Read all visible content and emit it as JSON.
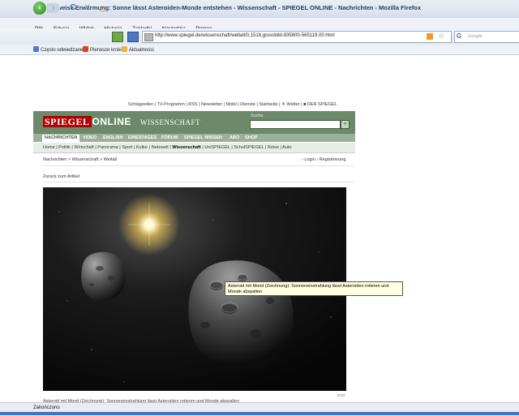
{
  "window": {
    "title": "Teilweise Erwärmung: Sonne lässt Asteroiden-Monde entstehen - Wissenschaft - SPIEGEL ONLINE - Nachrichten - Mozilla Firefox"
  },
  "menu": {
    "items": [
      "Plik",
      "Edycja",
      "Widok",
      "Historia",
      "Zakładki",
      "Narzędzia",
      "Pomoc"
    ]
  },
  "toolbar": {
    "back": "‹",
    "forward": "›",
    "reload": "C",
    "stop": "✕",
    "home": "⌂",
    "url": "http://www.spiegel.de/wissenschaft/weltall/0,1518,grossbild-835800-565119,00.html",
    "search_placeholder": "Google"
  },
  "bookmarks": {
    "items": [
      {
        "label": "Często odwiedzane",
        "color": "#4a7bd0"
      },
      {
        "label": "Pierwsze kroki",
        "color": "#d8431b"
      },
      {
        "label": "Aktualności",
        "color": "#e8b53a"
      }
    ]
  },
  "spiegel": {
    "top_links": "Schlagzeilen | TV-Programm | RSS | Newsletter | Mobil | Dienste | Startseite | ☀ Wetter | ■ DER SPIEGEL",
    "logo_spiegel": "SPIEGEL",
    "logo_online": "ONLINE",
    "section_title": "WISSENSCHAFT",
    "search_label": "Suche",
    "search_button": "»",
    "tabs": [
      "NACHRICHTEN",
      "VIDEO",
      "ENGLISH",
      "EINESTAGES",
      "FORUM",
      "SPIEGEL WISSEN",
      "ABO",
      "SHOP"
    ],
    "subnav": [
      "Home",
      "Politik",
      "Wirtschaft",
      "Panorama",
      "Sport",
      "Kultur",
      "Netzwelt",
      "Wissenschaft",
      "UniSPIEGEL",
      "SchulSPIEGEL",
      "Reise",
      "Auto"
    ],
    "subnav_active": "Wissenschaft",
    "breadcrumb": "Nachrichten > Wissenschaft > Weltall",
    "login_links": "› Login  › Registrierung",
    "back_link": "Zurück zum Artikel",
    "tooltip": "Asteroid mit Mond (Zeichnung): Sonneneinstrahlung lässt Asteroiden rotieren und Monde abspalten",
    "credit": "ESO",
    "caption": "Asteroid mit Mond (Zeichnung): Sonneneinstrahlung lässt Asteroiden rotieren und Monde abspalten"
  },
  "status": {
    "text": "Zakończono"
  },
  "colors": {
    "header_green": "#6c8a6a",
    "logo_red": "#b20000",
    "tab_green": "#9bb098"
  }
}
